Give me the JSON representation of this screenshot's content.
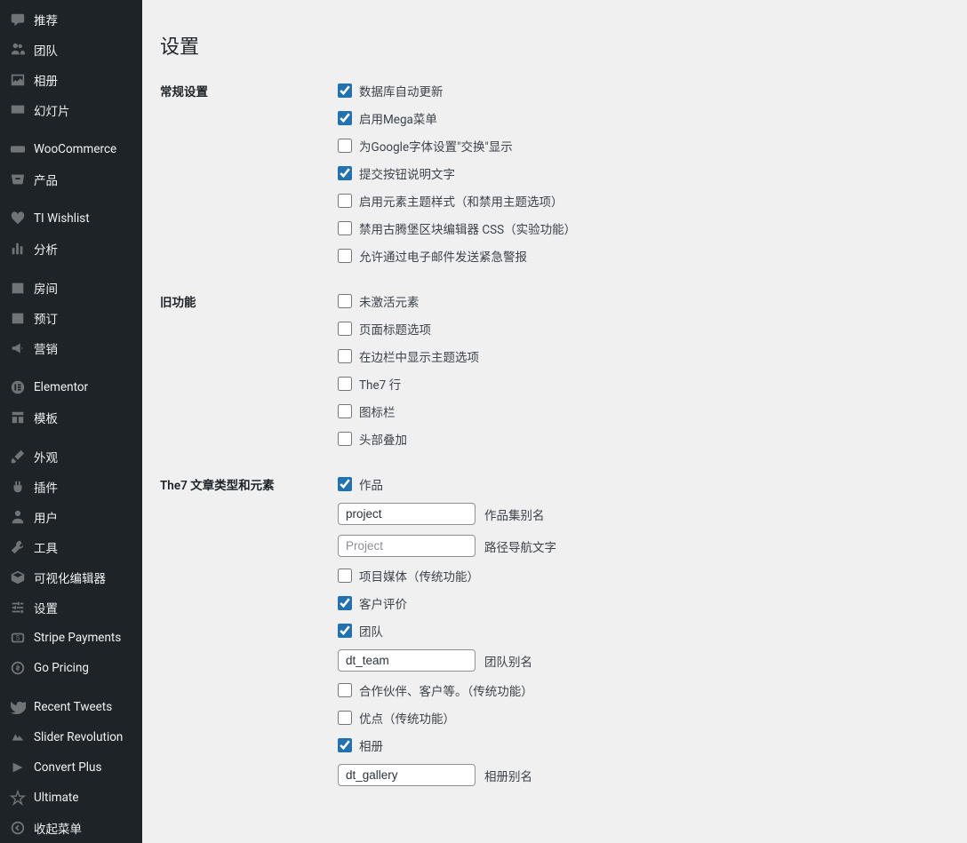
{
  "sidebar": {
    "items": [
      {
        "label": "推荐",
        "icon": "comment"
      },
      {
        "label": "团队",
        "icon": "users"
      },
      {
        "label": "相册",
        "icon": "images"
      },
      {
        "label": "幻灯片",
        "icon": "slides"
      },
      {
        "spacer": true
      },
      {
        "label": "WooCommerce",
        "icon": "woo"
      },
      {
        "label": "产品",
        "icon": "product"
      },
      {
        "spacer": true
      },
      {
        "label": "TI Wishlist",
        "icon": "heart"
      },
      {
        "label": "分析",
        "icon": "chart"
      },
      {
        "spacer": true
      },
      {
        "label": "房间",
        "icon": "calendar"
      },
      {
        "label": "预订",
        "icon": "booking"
      },
      {
        "label": "营销",
        "icon": "megaphone"
      },
      {
        "spacer": true
      },
      {
        "label": "Elementor",
        "icon": "elementor"
      },
      {
        "label": "模板",
        "icon": "template"
      },
      {
        "spacer": true
      },
      {
        "label": "外观",
        "icon": "brush"
      },
      {
        "label": "插件",
        "icon": "plugin"
      },
      {
        "label": "用户",
        "icon": "user"
      },
      {
        "label": "工具",
        "icon": "wrench"
      },
      {
        "label": "可视化编辑器",
        "icon": "visual"
      },
      {
        "label": "设置",
        "icon": "settings"
      },
      {
        "label": "Stripe Payments",
        "icon": "stripe"
      },
      {
        "label": "Go Pricing",
        "icon": "pricing"
      },
      {
        "spacer": true
      },
      {
        "label": "Recent Tweets",
        "icon": "twitter"
      },
      {
        "label": "Slider Revolution",
        "icon": "slider"
      },
      {
        "label": "Convert Plus",
        "icon": "convert"
      },
      {
        "label": "Ultimate",
        "icon": "ultimate"
      },
      {
        "label": "收起菜单",
        "icon": "collapse"
      }
    ]
  },
  "page": {
    "title": "设置"
  },
  "sections": {
    "general": {
      "label": "常规设置",
      "options": [
        {
          "label": "数据库自动更新",
          "checked": true
        },
        {
          "label": "启用Mega菜单",
          "checked": true
        },
        {
          "label": "为Google字体设置\"交换\"显示",
          "checked": false
        },
        {
          "label": "提交按钮说明文字",
          "checked": true
        },
        {
          "label": "启用元素主题样式（和禁用主题选项）",
          "checked": false
        },
        {
          "label": "禁用古腾堡区块编辑器 CSS（实验功能）",
          "checked": false
        },
        {
          "label": "允许通过电子邮件发送紧急警报",
          "checked": false
        }
      ]
    },
    "legacy": {
      "label": "旧功能",
      "options": [
        {
          "label": "未激活元素",
          "checked": false
        },
        {
          "label": "页面标题选项",
          "checked": false
        },
        {
          "label": "在边栏中显示主题选项",
          "checked": false
        },
        {
          "label": "The7 行",
          "checked": false
        },
        {
          "label": "图标栏",
          "checked": false
        },
        {
          "label": "头部叠加",
          "checked": false
        }
      ]
    },
    "posttypes": {
      "label": "The7 文章类型和元素",
      "works_checked": true,
      "works_label": "作品",
      "works_slug_value": "project",
      "works_slug_label": "作品集别名",
      "works_breadcrumb_placeholder": "Project",
      "works_breadcrumb_label": "路径导航文字",
      "media_label": "项目媒体（传统功能）",
      "media_checked": false,
      "testimonials_label": "客户评价",
      "testimonials_checked": true,
      "team_label": "团队",
      "team_checked": true,
      "team_slug_value": "dt_team",
      "team_slug_label": "团队别名",
      "partners_label": "合作伙伴、客户等。（传统功能）",
      "partners_checked": false,
      "benefits_label": "优点（传统功能）",
      "benefits_checked": false,
      "gallery_label": "相册",
      "gallery_checked": true,
      "gallery_slug_value": "dt_gallery",
      "gallery_slug_label": "相册别名"
    }
  }
}
